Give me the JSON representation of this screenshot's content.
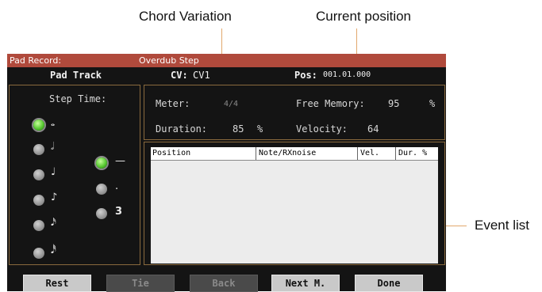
{
  "callouts": {
    "chord_variation": "Chord Variation",
    "current_position": "Current position",
    "event_list": "Event list"
  },
  "titlebar": {
    "title": "Pad Record:",
    "mode": "Overdub Step"
  },
  "subbar": {
    "track": "Pad Track",
    "cv_label": "CV:",
    "cv_value": "CV1",
    "pos_label": "Pos:",
    "pos_value": "001.01.000"
  },
  "step_time": {
    "label": "Step Time:",
    "notes": [
      "𝅝",
      "𝅗𝅥",
      "♩",
      "♪",
      "𝅘𝅥𝅯",
      "𝅘𝅥𝅰"
    ],
    "modifiers": [
      "—",
      ".",
      "3"
    ],
    "selected_note": 0,
    "selected_modifier": 0
  },
  "info": {
    "meter_label": "Meter:",
    "meter_value": "4/4",
    "free_memory_label": "Free Memory:",
    "free_memory_value": "95",
    "percent": "%",
    "duration_label": "Duration:",
    "duration_value": "85",
    "velocity_label": "Velocity:",
    "velocity_value": "64"
  },
  "event_table": {
    "columns": [
      "Position",
      "Note/RXnoise",
      "Vel.",
      "Dur. %"
    ],
    "rows": []
  },
  "buttons": [
    {
      "label": "Rest",
      "enabled": true
    },
    {
      "label": "Tie",
      "enabled": false
    },
    {
      "label": "Back",
      "enabled": false
    },
    {
      "label": "Next M.",
      "enabled": true
    },
    {
      "label": "Done",
      "enabled": true
    }
  ],
  "colors": {
    "titlebar_bg": "#b04a3c",
    "callout_line": "#e2a86d",
    "radio_on": "#56c830"
  }
}
